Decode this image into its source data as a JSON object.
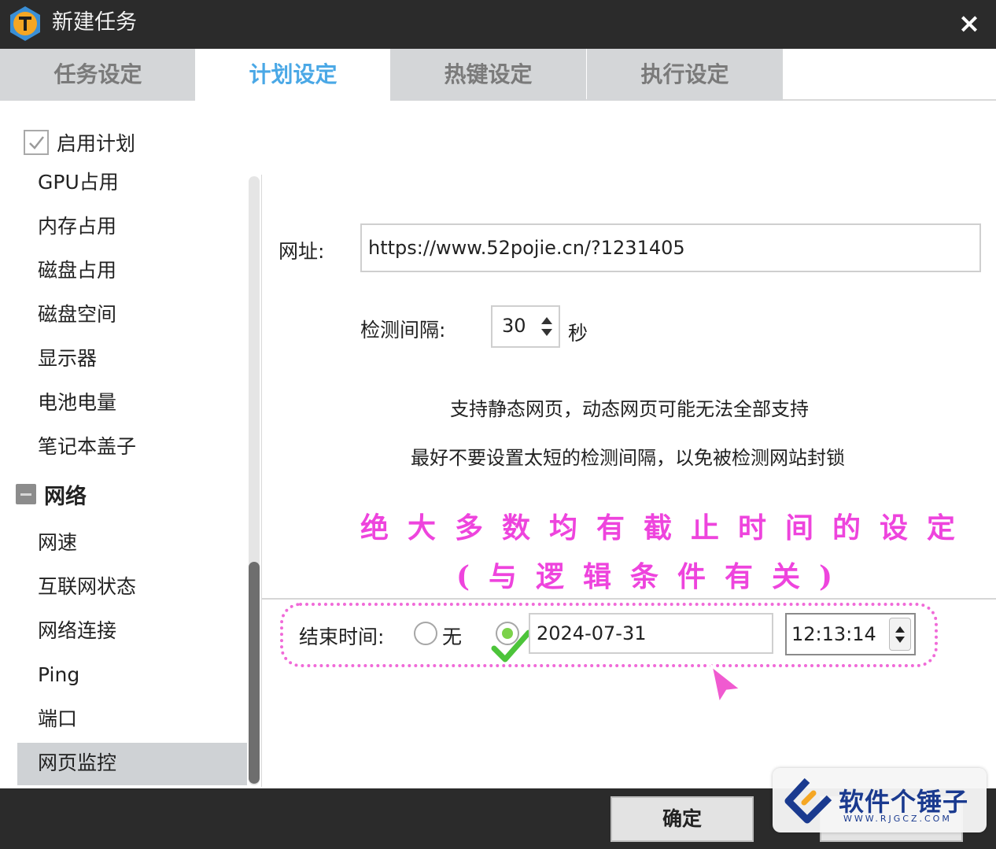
{
  "window": {
    "title": "新建任务",
    "close_label": "×"
  },
  "tabs": [
    {
      "label": "任务设定"
    },
    {
      "label": "计划设定"
    },
    {
      "label": "热键设定"
    },
    {
      "label": "执行设定"
    }
  ],
  "sidebar": {
    "enable_label": "启用计划",
    "items_a": [
      "GPU占用",
      "内存占用",
      "磁盘占用",
      "磁盘空间",
      "显示器",
      "电池电量",
      "笔记本盖子"
    ],
    "group_label": "网络",
    "items_b": [
      "网速",
      "互联网状态",
      "网络连接",
      "Ping",
      "端口",
      "网页监控"
    ],
    "selected": "网页监控"
  },
  "form": {
    "url_label": "网址:",
    "url_value": "https://www.52pojie.cn/?1231405",
    "interval_label": "检测间隔:",
    "interval_value": "30",
    "interval_unit": "秒",
    "note_1": "支持静态网页，动态网页可能无法全部支持",
    "note_2": "最好不要设置太短的检测间隔，以免被检测网站封锁",
    "end_time_label": "结束时间:",
    "none_label": "无",
    "date_value": "2024-07-31",
    "time_value": "12:13:14"
  },
  "annotation": {
    "line_1": "绝大多数均有截止时间的设定",
    "line_2": "(与逻辑条件有关)"
  },
  "footer": {
    "ok_label": "确定"
  },
  "watermark": {
    "brand": "软件个锤子",
    "site": "WWW.RJGCZ.COM"
  },
  "colors": {
    "accent_tab": "#4aa8e6",
    "annotation": "#ee44dd",
    "radio_on": "#7bd24a",
    "titlebar": "#2b2b2b"
  }
}
